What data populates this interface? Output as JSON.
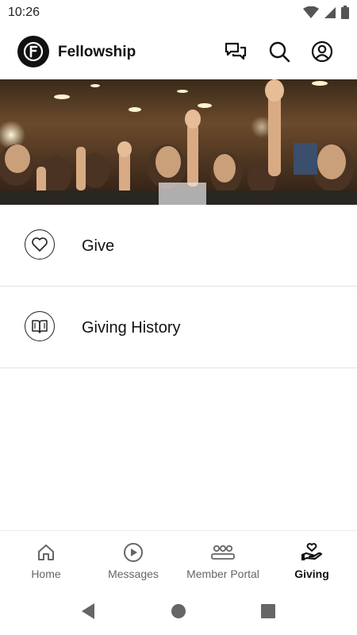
{
  "status_bar": {
    "time": "10:26"
  },
  "app_bar": {
    "title": "Fellowship",
    "logo_letter": "F",
    "actions": [
      "chat-icon",
      "search-icon",
      "account-icon"
    ]
  },
  "hero": {
    "description": ""
  },
  "menu": {
    "items": [
      {
        "label": "Give",
        "icon": "heart-icon"
      },
      {
        "label": "Giving History",
        "icon": "book-icon"
      }
    ]
  },
  "bottom_nav": {
    "active": "Giving",
    "items": [
      {
        "label": "Home",
        "icon": "home-icon"
      },
      {
        "label": "Messages",
        "icon": "play-circle-icon"
      },
      {
        "label": "Member Portal",
        "icon": "group-icon"
      },
      {
        "label": "Giving",
        "icon": "giving-hand-icon"
      }
    ]
  },
  "colors": {
    "text": "#111111",
    "inactive_nav": "#666666",
    "divider": "#e3e3e3"
  }
}
